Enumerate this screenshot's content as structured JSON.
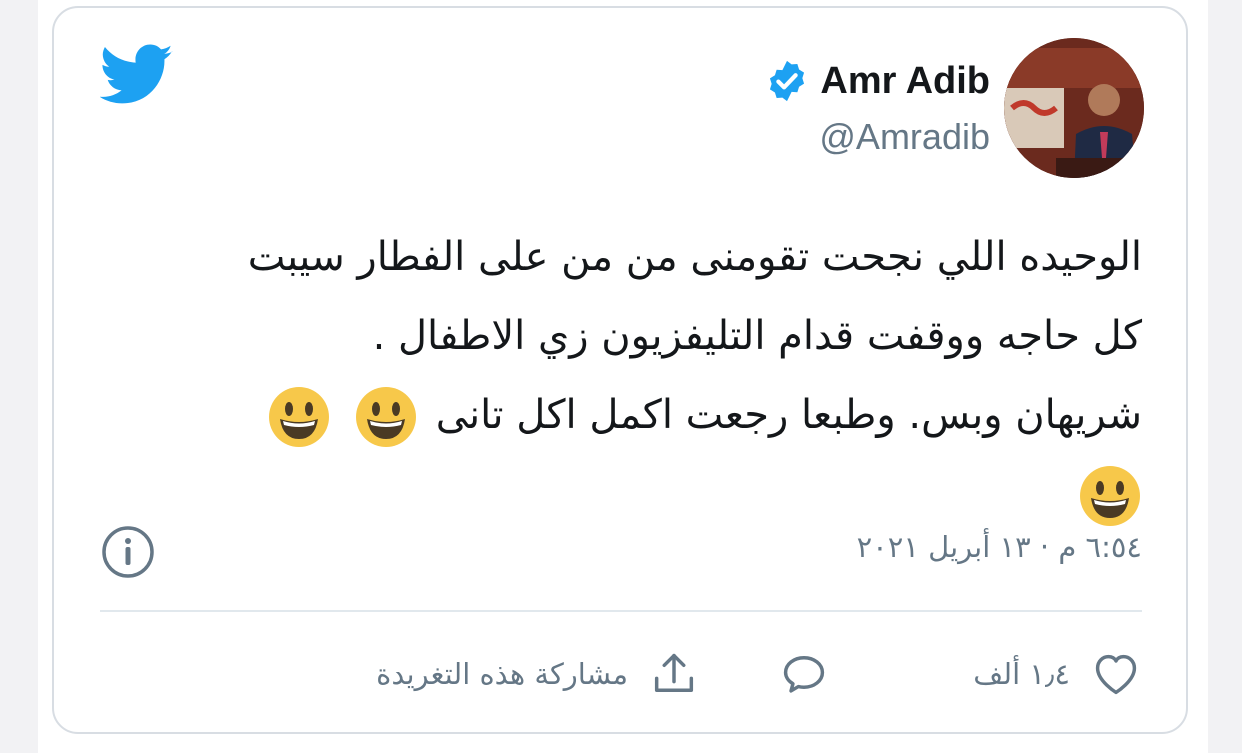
{
  "author": {
    "name": "Amr Adib",
    "handle": "@Amradib",
    "verified": true
  },
  "tweet": {
    "line1": "الوحيده اللي نجحت تقومنى من من على الفطار سيبت",
    "line2": "كل حاجه ووقفت قدام التليفزيون زي الاطفال .",
    "line3": "شريهان وبس. وطبعا رجعت اكمل اكل تانى"
  },
  "timestamp": "٦:٥٤ م · ١٣ أبريل ٢٠٢١",
  "actions": {
    "likes": "١٫٤ ألف",
    "share_label": "مشاركة هذه التغريدة"
  },
  "colors": {
    "brand": "#1DA1F2",
    "verified": "#1DA1F2",
    "text": "#14171a",
    "secondary": "#657786",
    "emoji_face": "#f7c84a"
  },
  "icons": [
    "twitter-logo-icon",
    "verified-badge-icon",
    "info-icon",
    "heart-icon",
    "reply-icon",
    "share-icon",
    "grinning-face-emoji"
  ]
}
